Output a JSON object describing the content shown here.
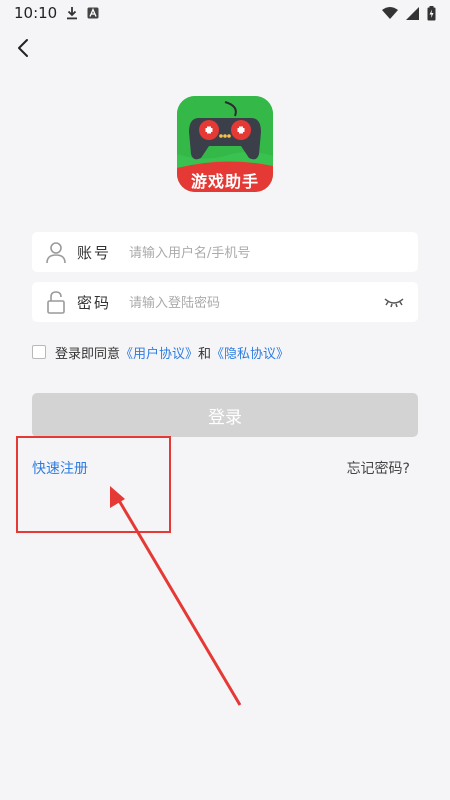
{
  "status_bar": {
    "time": "10:10",
    "icons": [
      "download-icon",
      "a-box-icon",
      "wifi-icon",
      "signal-icon",
      "battery-icon"
    ]
  },
  "app": {
    "logo_text": "游戏助手"
  },
  "login_form": {
    "account": {
      "label": "账号",
      "placeholder": "请输入用户名/手机号"
    },
    "password": {
      "label": "密码",
      "placeholder": "请输入登陆密码"
    },
    "agreement": {
      "prefix": "登录即同意",
      "user_agreement": "《用户协议》",
      "and": "和",
      "privacy_policy": "《隐私协议》"
    },
    "login_label": "登录",
    "quick_register": "快速注册",
    "forgot_password": "忘记密码?"
  },
  "colors": {
    "link": "#2f7de1",
    "annotation": "#e53935",
    "button_disabled": "#d3d3d3"
  }
}
